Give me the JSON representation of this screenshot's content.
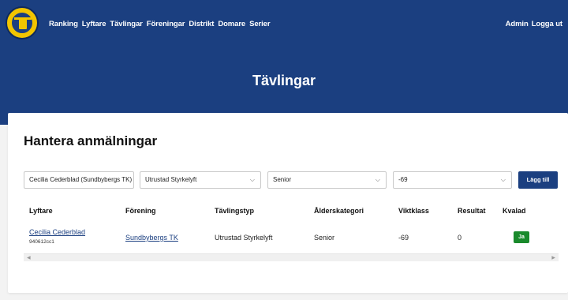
{
  "nav": {
    "items": [
      "Ranking",
      "Lyftare",
      "Tävlingar",
      "Föreningar",
      "Distrikt",
      "Domare",
      "Serier"
    ],
    "right": [
      "Admin",
      "Logga ut"
    ]
  },
  "hero": {
    "title": "Tävlingar"
  },
  "card": {
    "title": "Hantera anmälningar"
  },
  "form": {
    "lifter": "Cecilia Cederblad (Sundbybergs TK)",
    "competition_type": "Utrustad Styrkelyft",
    "age_category": "Senior",
    "weight_class": "-69",
    "add_label": "Lägg till",
    "chevron": "⌵"
  },
  "table": {
    "headers": [
      "Lyftare",
      "Förening",
      "Tävlingstyp",
      "Ålderskategori",
      "Viktklass",
      "Resultat",
      "Kvalad"
    ],
    "row": {
      "lifter_name": "Cecilia Cederblad",
      "lifter_id": "940612cc1",
      "club": "Sundbybergs TK",
      "type": "Utrustad Styrkelyft",
      "age": "Senior",
      "weight": "-69",
      "result": "0",
      "qualified": "Ja"
    }
  },
  "scroll": {
    "left": "◀",
    "right": "▶"
  }
}
